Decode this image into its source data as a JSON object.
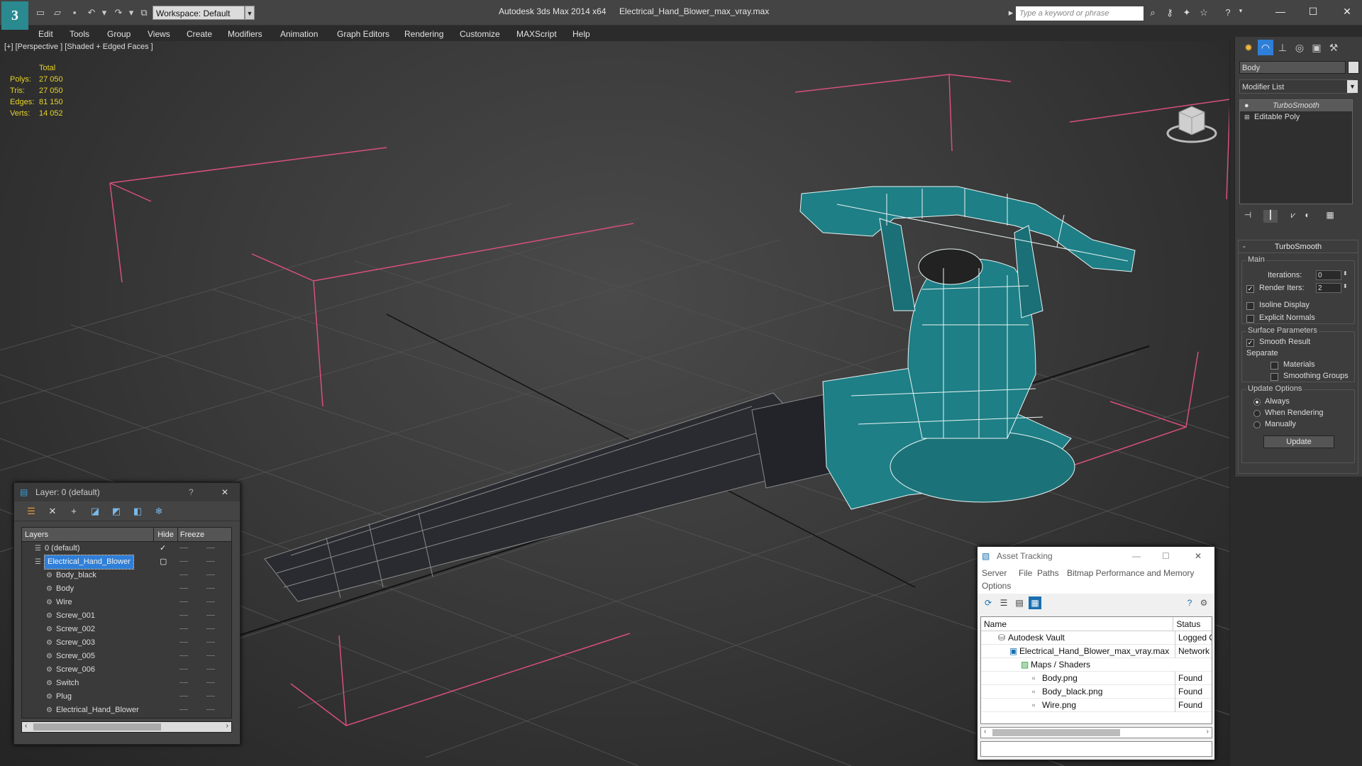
{
  "titlebar": {
    "app_title": "Autodesk 3ds Max  2014 x64",
    "file_title": "Electrical_Hand_Blower_max_vray.max",
    "workspace": "Workspace: Default",
    "search_placeholder": "Type a keyword or phrase",
    "logo": "3"
  },
  "menu": [
    "Edit",
    "Tools",
    "Group",
    "Views",
    "Create",
    "Modifiers",
    "Animation",
    "Graph Editors",
    "Rendering",
    "Customize",
    "MAXScript",
    "Help"
  ],
  "viewport": {
    "label": "[+] [Perspective ] [Shaded + Edged Faces ]",
    "stats_header": "Total",
    "stats": [
      {
        "k": "Polys:",
        "v": "27 050"
      },
      {
        "k": "Tris:",
        "v": "27 050"
      },
      {
        "k": "Edges:",
        "v": "81 150"
      },
      {
        "k": "Verts:",
        "v": "14 052"
      }
    ]
  },
  "command_panel": {
    "object_name": "Body",
    "modifier_list": "Modifier List",
    "stack": [
      "TurboSmooth",
      "Editable Poly"
    ],
    "rollout_title": "TurboSmooth",
    "main_group": "Main",
    "iterations_label": "Iterations:",
    "iterations_value": "0",
    "render_iters_label": "Render Iters:",
    "render_iters_value": "2",
    "isoline": "Isoline Display",
    "explicit": "Explicit Normals",
    "surface_group": "Surface Parameters",
    "smooth_result": "Smooth Result",
    "separate": "Separate",
    "materials": "Materials",
    "smoothing_groups": "Smoothing Groups",
    "update_group": "Update Options",
    "always": "Always",
    "when_rendering": "When Rendering",
    "manually": "Manually",
    "update_btn": "Update"
  },
  "layer_window": {
    "title": "Layer: 0 (default)",
    "help": "?",
    "cols": {
      "layers": "Layers",
      "hide": "Hide",
      "freeze": "Freeze"
    },
    "rows": [
      {
        "name": "0 (default)",
        "indent": 0,
        "check": true
      },
      {
        "name": "Electrical_Hand_Blower",
        "indent": 0,
        "selected": true
      },
      {
        "name": "Body_black",
        "indent": 1
      },
      {
        "name": "Body",
        "indent": 1
      },
      {
        "name": "Wire",
        "indent": 1
      },
      {
        "name": "Screw_001",
        "indent": 1
      },
      {
        "name": "Screw_002",
        "indent": 1
      },
      {
        "name": "Screw_003",
        "indent": 1
      },
      {
        "name": "Screw_005",
        "indent": 1
      },
      {
        "name": "Screw_006",
        "indent": 1
      },
      {
        "name": "Switch",
        "indent": 1
      },
      {
        "name": "Plug",
        "indent": 1
      },
      {
        "name": "Electrical_Hand_Blower",
        "indent": 1
      }
    ]
  },
  "asset_window": {
    "title": "Asset Tracking",
    "menu": [
      "Server",
      "File",
      "Paths",
      "Bitmap Performance and Memory"
    ],
    "menu2": "Options",
    "cols": {
      "name": "Name",
      "status": "Status"
    },
    "rows": [
      {
        "name": "Autodesk Vault",
        "status": "Logged O",
        "indent": 0
      },
      {
        "name": "Electrical_Hand_Blower_max_vray.max",
        "status": "Network",
        "indent": 1
      },
      {
        "name": "Maps / Shaders",
        "status": "",
        "indent": 2
      },
      {
        "name": "Body.png",
        "status": "Found",
        "indent": 3
      },
      {
        "name": "Body_black.png",
        "status": "Found",
        "indent": 3
      },
      {
        "name": "Wire.png",
        "status": "Found",
        "indent": 3
      }
    ]
  },
  "colors": {
    "mesh": "#1e7f86",
    "wire": "#e8f4f4",
    "bbox": "#d8507a",
    "accent": "#2f7fd8"
  }
}
